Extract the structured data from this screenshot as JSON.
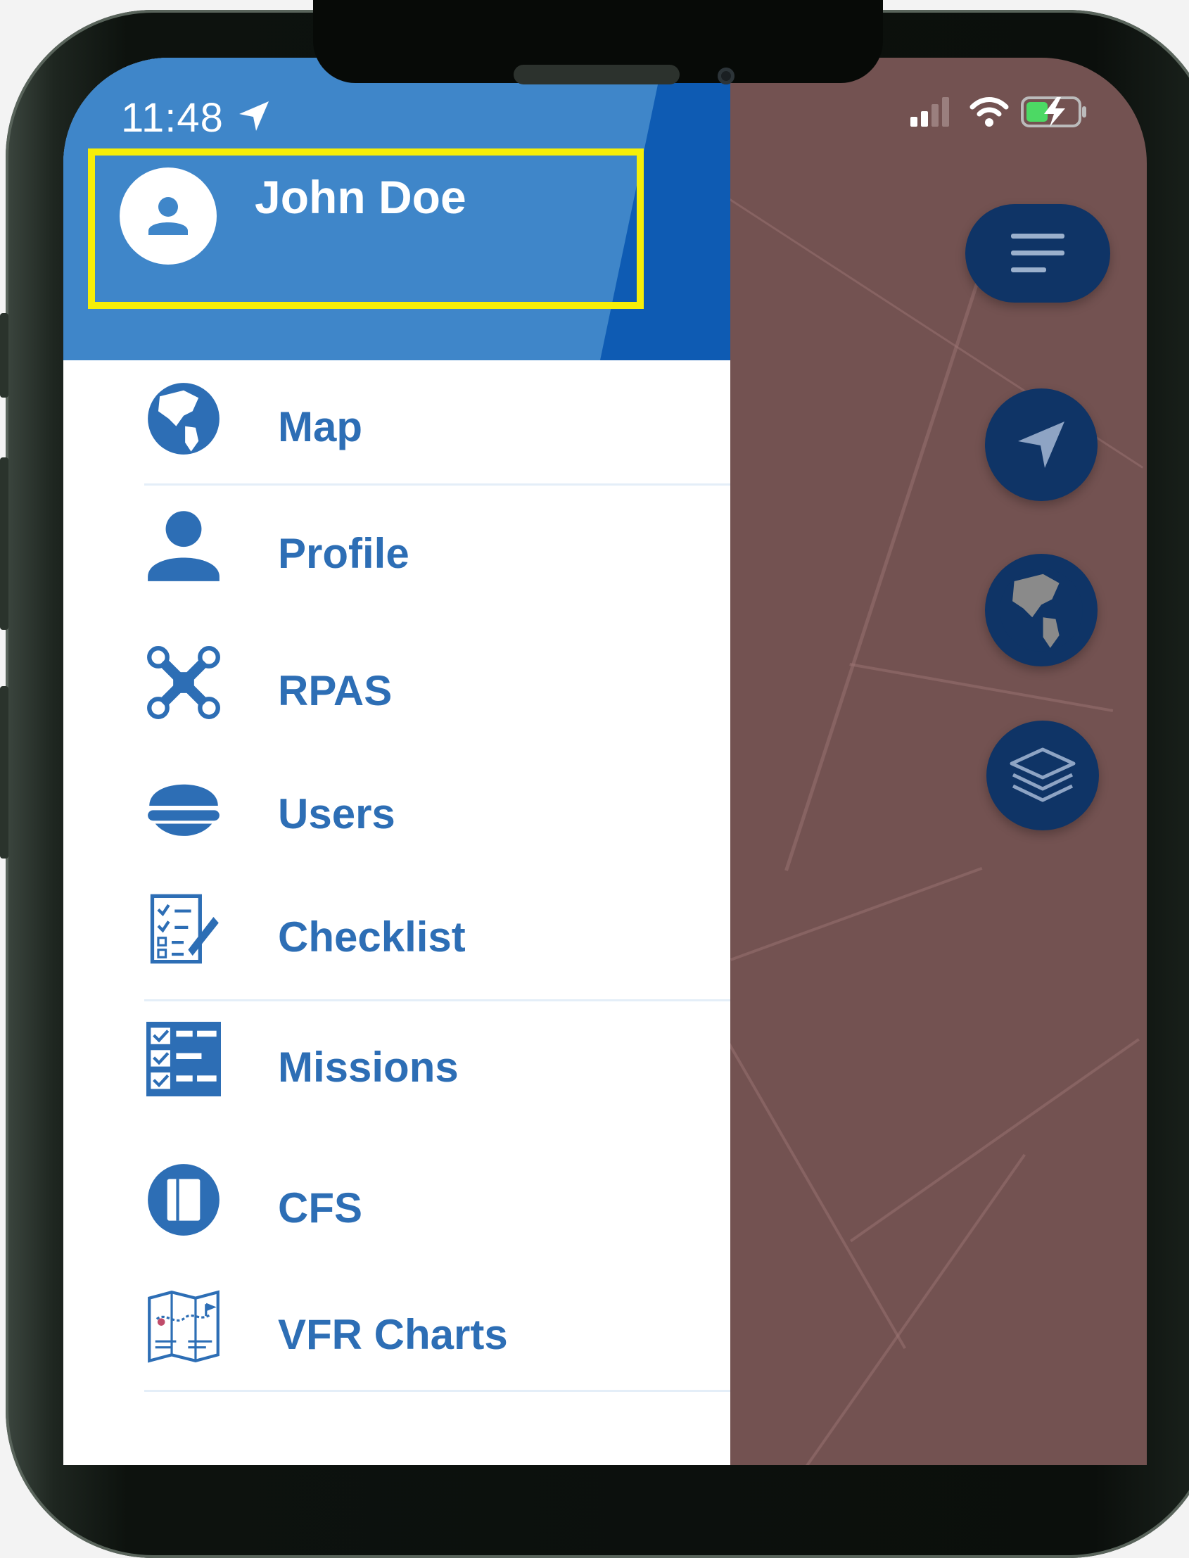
{
  "status_bar": {
    "time": "11:48"
  },
  "drawer": {
    "user_name": "John Doe",
    "menu": [
      {
        "label": "Map",
        "icon": "globe-icon"
      },
      {
        "label": "Profile",
        "icon": "person-icon"
      },
      {
        "label": "RPAS",
        "icon": "drone-icon"
      },
      {
        "label": "Users",
        "icon": "pilot-cap-icon"
      },
      {
        "label": "Checklist",
        "icon": "checklist-icon"
      },
      {
        "label": "Missions",
        "icon": "missions-list-icon"
      },
      {
        "label": "CFS",
        "icon": "book-icon"
      },
      {
        "label": "VFR Charts",
        "icon": "chart-map-icon"
      }
    ]
  },
  "map_controls": [
    "menu-icon",
    "navigation-arrow-icon",
    "globe-icon",
    "layers-icon"
  ],
  "colors": {
    "drawer_header": "#3f86c9",
    "menu_text": "#2d6eb5",
    "highlight": "#f6ee08",
    "map_overlay": "#735251",
    "fab": "#0f3466"
  }
}
